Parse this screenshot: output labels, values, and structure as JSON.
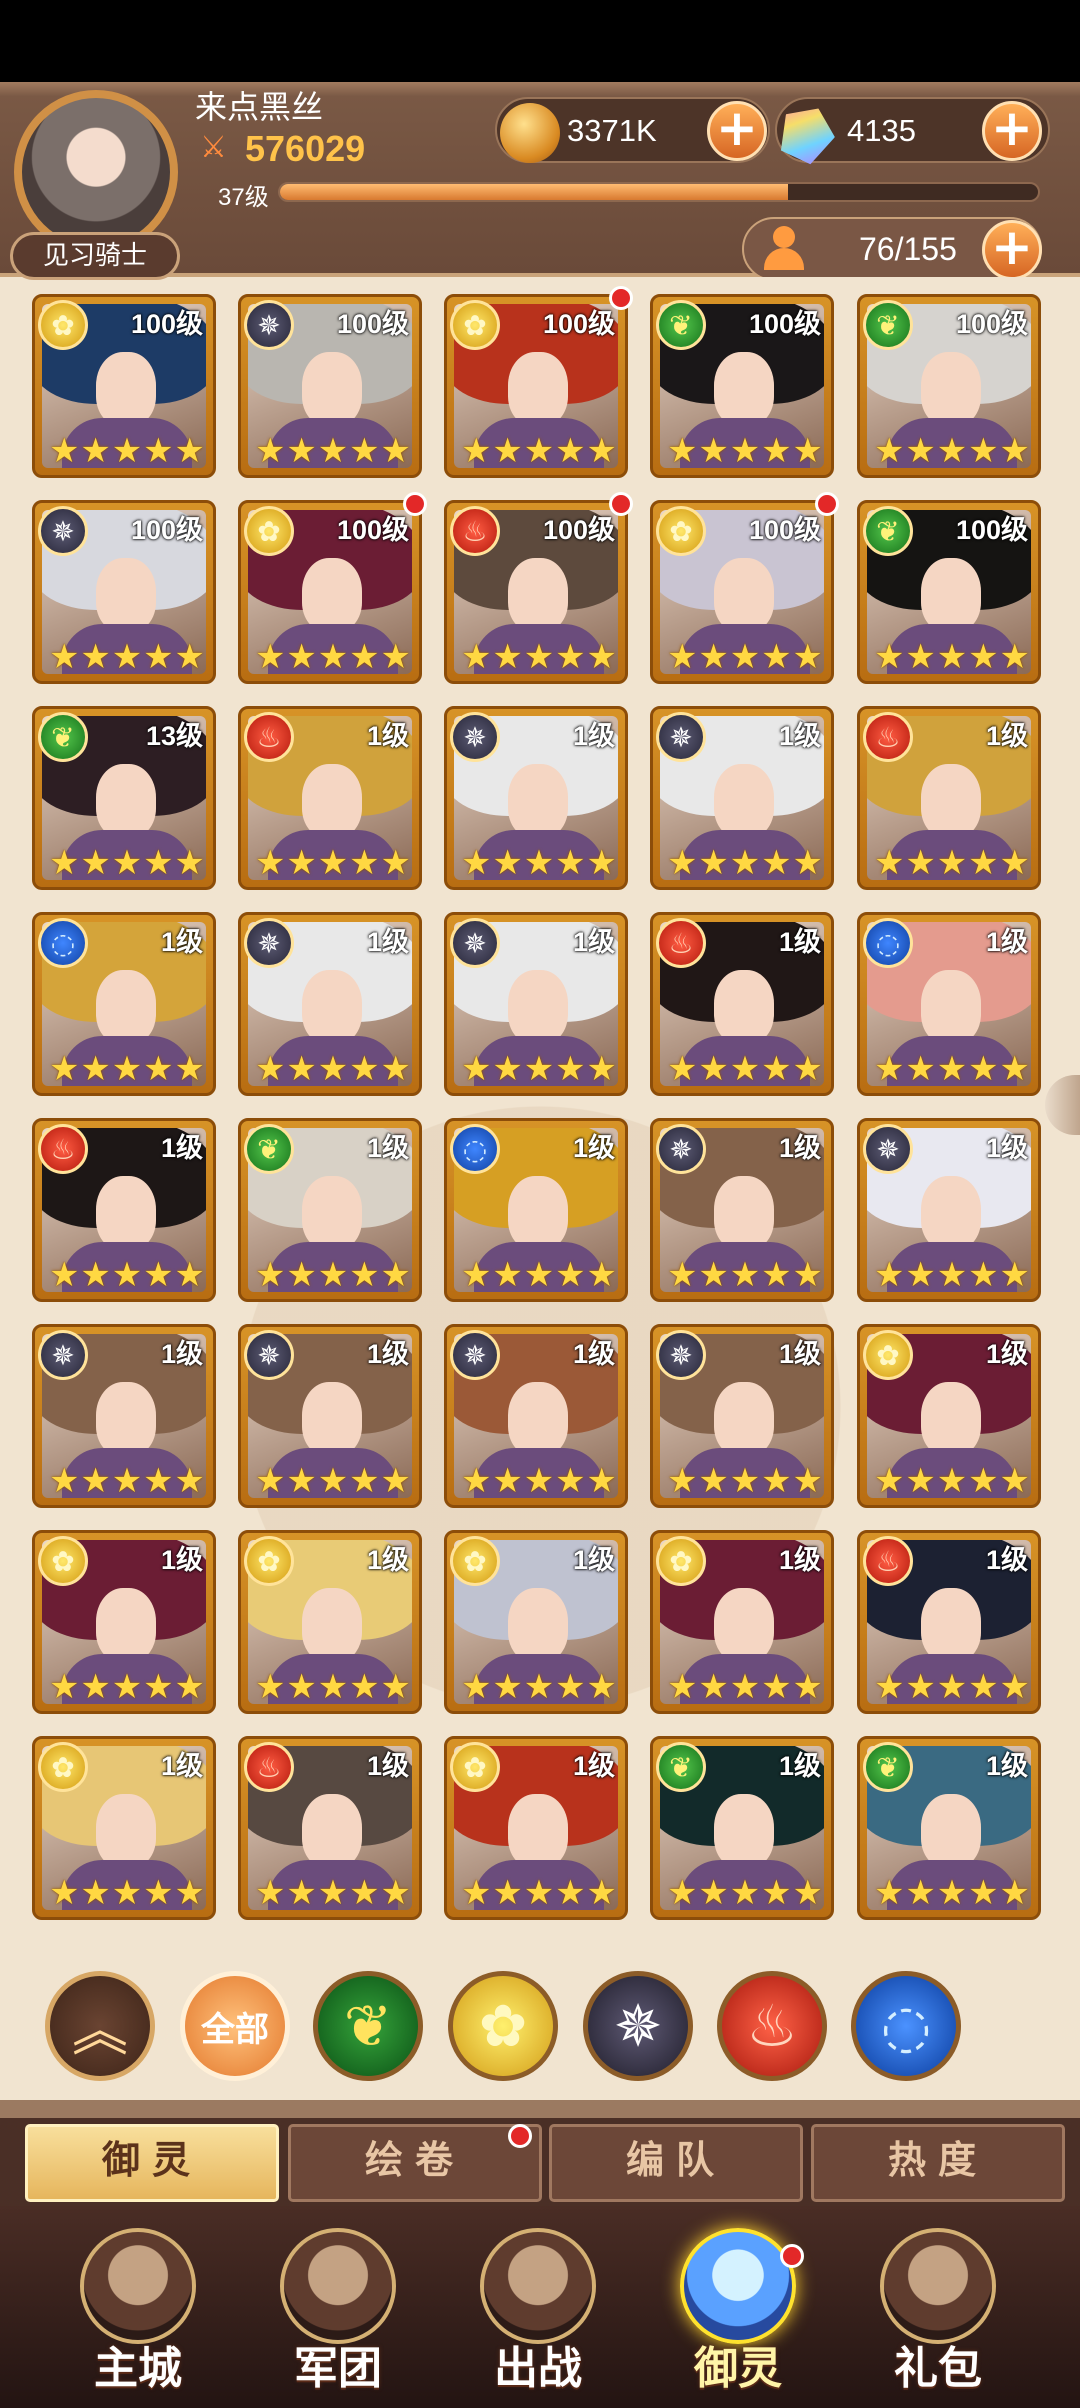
{
  "player": {
    "name": "来点黑丝",
    "power": "576029",
    "level_label": "37级",
    "exp_fraction": 0.67,
    "rank": "见习骑士"
  },
  "currencies": {
    "coins": "3371K",
    "gems": "4135",
    "capacity": "76/155"
  },
  "factions": {
    "gold": {
      "name": "gold",
      "color": "#e1aa15",
      "icon": "rose-icon"
    },
    "wood": {
      "name": "wood",
      "color": "#1d8e26",
      "icon": "leaf-swirl-icon"
    },
    "shadow": {
      "name": "shadow",
      "color": "#2f2d40",
      "icon": "star-web-icon"
    },
    "fire": {
      "name": "fire",
      "color": "#ce2718",
      "icon": "phoenix-icon"
    },
    "water": {
      "name": "water",
      "color": "#1f58c6",
      "icon": "wave-icon"
    }
  },
  "cards": [
    {
      "level": "100级",
      "faction": "gold",
      "notice": false
    },
    {
      "level": "100级",
      "faction": "shadow",
      "notice": false
    },
    {
      "level": "100级",
      "faction": "gold",
      "notice": true
    },
    {
      "level": "100级",
      "faction": "wood",
      "notice": false
    },
    {
      "level": "100级",
      "faction": "wood",
      "notice": false
    },
    {
      "level": "100级",
      "faction": "shadow",
      "notice": false
    },
    {
      "level": "100级",
      "faction": "gold",
      "notice": true
    },
    {
      "level": "100级",
      "faction": "fire",
      "notice": true
    },
    {
      "level": "100级",
      "faction": "gold",
      "notice": true
    },
    {
      "level": "100级",
      "faction": "wood",
      "notice": false
    },
    {
      "level": "13级",
      "faction": "wood",
      "notice": false
    },
    {
      "level": "1级",
      "faction": "fire",
      "notice": false
    },
    {
      "level": "1级",
      "faction": "shadow",
      "notice": false
    },
    {
      "level": "1级",
      "faction": "shadow",
      "notice": false
    },
    {
      "level": "1级",
      "faction": "fire",
      "notice": false
    },
    {
      "level": "1级",
      "faction": "water",
      "notice": false
    },
    {
      "level": "1级",
      "faction": "shadow",
      "notice": false
    },
    {
      "level": "1级",
      "faction": "shadow",
      "notice": false
    },
    {
      "level": "1级",
      "faction": "fire",
      "notice": false
    },
    {
      "level": "1级",
      "faction": "water",
      "notice": false
    },
    {
      "level": "1级",
      "faction": "fire",
      "notice": false
    },
    {
      "level": "1级",
      "faction": "wood",
      "notice": false
    },
    {
      "level": "1级",
      "faction": "water",
      "notice": false
    },
    {
      "level": "1级",
      "faction": "shadow",
      "notice": false
    },
    {
      "level": "1级",
      "faction": "shadow",
      "notice": false
    },
    {
      "level": "1级",
      "faction": "shadow",
      "notice": false
    },
    {
      "level": "1级",
      "faction": "shadow",
      "notice": false
    },
    {
      "level": "1级",
      "faction": "shadow",
      "notice": false
    },
    {
      "level": "1级",
      "faction": "shadow",
      "notice": false
    },
    {
      "level": "1级",
      "faction": "gold",
      "notice": false
    },
    {
      "level": "1级",
      "faction": "gold",
      "notice": false
    },
    {
      "level": "1级",
      "faction": "gold",
      "notice": false
    },
    {
      "level": "1级",
      "faction": "gold",
      "notice": false
    },
    {
      "level": "1级",
      "faction": "gold",
      "notice": false
    },
    {
      "level": "1级",
      "faction": "fire",
      "notice": false
    },
    {
      "level": "1级",
      "faction": "gold",
      "notice": false
    },
    {
      "level": "1级",
      "faction": "fire",
      "notice": false
    },
    {
      "level": "1级",
      "faction": "gold",
      "notice": false
    },
    {
      "level": "1级",
      "faction": "wood",
      "notice": false
    },
    {
      "level": "1级",
      "faction": "wood",
      "notice": false
    }
  ],
  "filters": {
    "all_label": "全部"
  },
  "tabs": [
    {
      "label": "御灵",
      "active": true,
      "notice": false
    },
    {
      "label": "绘卷",
      "active": false,
      "notice": true
    },
    {
      "label": "编队",
      "active": false,
      "notice": false
    },
    {
      "label": "热度",
      "active": false,
      "notice": false
    }
  ],
  "nav": [
    {
      "label": "主城",
      "active": false,
      "notice": false
    },
    {
      "label": "军团",
      "active": false,
      "notice": false
    },
    {
      "label": "出战",
      "active": false,
      "notice": false
    },
    {
      "label": "御灵",
      "active": true,
      "notice": true
    },
    {
      "label": "礼包",
      "active": false,
      "notice": false
    }
  ]
}
